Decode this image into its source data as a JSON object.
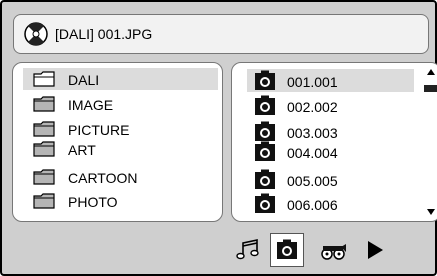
{
  "header": {
    "title": "[DALI] 001.JPG",
    "disc_icon": "disc-icon"
  },
  "folders": {
    "items": [
      {
        "label": "DALI",
        "icon": "folder-open-icon",
        "selected": true
      },
      {
        "label": "IMAGE",
        "icon": "folder-icon",
        "selected": false
      },
      {
        "label": "PICTURE",
        "icon": "folder-icon",
        "selected": false
      },
      {
        "label": "ART",
        "icon": "folder-icon",
        "selected": false
      },
      {
        "label": "CARTOON",
        "icon": "folder-icon",
        "selected": false
      },
      {
        "label": "PHOTO",
        "icon": "folder-icon",
        "selected": false
      }
    ]
  },
  "files": {
    "items": [
      {
        "label": "001.001",
        "icon": "camera-icon",
        "selected": true
      },
      {
        "label": "002.002",
        "icon": "camera-icon",
        "selected": false
      },
      {
        "label": "003.003",
        "icon": "camera-icon",
        "selected": false
      },
      {
        "label": "004.004",
        "icon": "camera-icon",
        "selected": false
      },
      {
        "label": "005.005",
        "icon": "camera-icon",
        "selected": false
      },
      {
        "label": "006.006",
        "icon": "camera-icon",
        "selected": false
      }
    ]
  },
  "toolbar": {
    "buttons": [
      {
        "icon": "music-note-icon",
        "active": false
      },
      {
        "icon": "camera-icon",
        "active": true
      },
      {
        "icon": "film-reel-icon",
        "active": false
      },
      {
        "icon": "play-icon",
        "active": false
      }
    ]
  },
  "colors": {
    "frame_bg": "#cfcfcf",
    "panel_bg": "#ffffff",
    "selection": "#dcdcdc"
  }
}
